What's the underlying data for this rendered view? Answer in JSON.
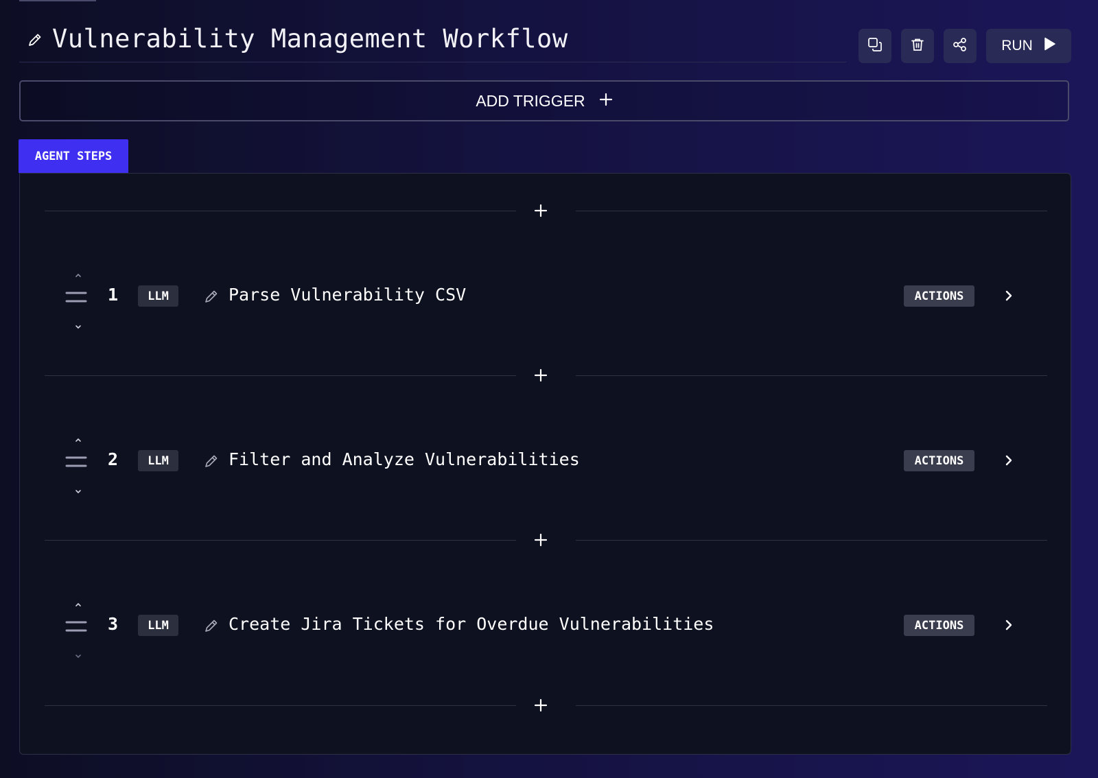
{
  "workflow": {
    "title": "Vulnerability Management Workflow"
  },
  "toolbar": {
    "run_label": "RUN",
    "icons": [
      "duplicate-icon",
      "trash-icon",
      "share-icon",
      "play-icon"
    ]
  },
  "trigger": {
    "add_label": "ADD TRIGGER"
  },
  "tabs": {
    "agent_steps": "AGENT STEPS"
  },
  "steps": [
    {
      "number": "1",
      "type": "LLM",
      "name": "Parse Vulnerability CSV",
      "actions_label": "ACTIONS"
    },
    {
      "number": "2",
      "type": "LLM",
      "name": "Filter and Analyze Vulnerabilities",
      "actions_label": "ACTIONS"
    },
    {
      "number": "3",
      "type": "LLM",
      "name": "Create Jira Tickets for Overdue Vulnerabilities",
      "actions_label": "ACTIONS"
    }
  ],
  "colors": {
    "accent_tab": "#3f2ff0",
    "panel_bg": "#0e1120",
    "button_bg": "#2a2a56",
    "badge_bg": "#2c2f3e",
    "actions_bg": "#3a3d4d"
  }
}
